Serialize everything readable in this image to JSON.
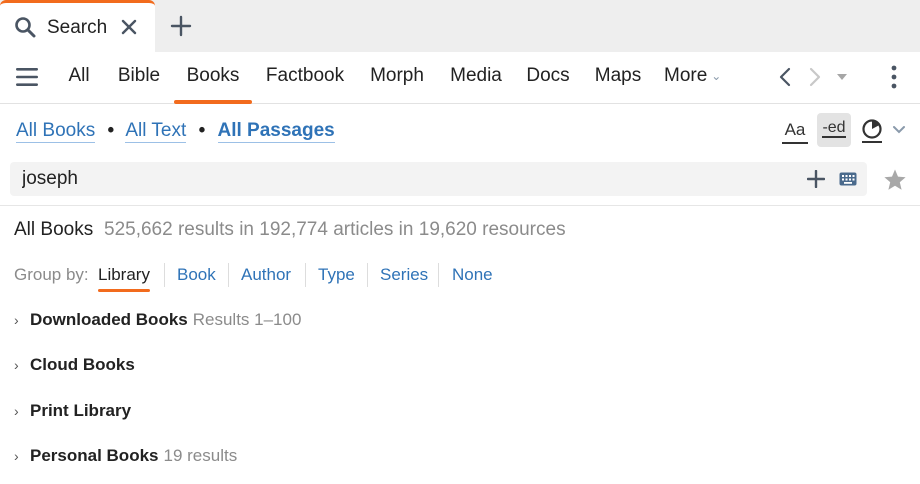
{
  "tab": {
    "title": "Search"
  },
  "nav": {
    "items": [
      {
        "label": "All"
      },
      {
        "label": "Bible"
      },
      {
        "label": "Books"
      },
      {
        "label": "Factbook"
      },
      {
        "label": "Morph"
      },
      {
        "label": "Media"
      },
      {
        "label": "Docs"
      },
      {
        "label": "Maps"
      },
      {
        "label": "More"
      }
    ],
    "active": "Books"
  },
  "scope": {
    "books": "All Books",
    "text": "All Text",
    "passages": "All Passages",
    "separator": "•"
  },
  "tools": {
    "font_label": "Aa",
    "ed_label": "-ed"
  },
  "search": {
    "value": "joseph"
  },
  "results": {
    "title": "All Books",
    "summary": "525,662 results in 192,774 articles in 19,620 resources"
  },
  "group_by": {
    "label": "Group by:",
    "options": [
      "Library",
      "Book",
      "Author",
      "Type",
      "Series",
      "None"
    ],
    "active": "Library"
  },
  "groups": [
    {
      "name": "Downloaded Books",
      "count": "Results 1–100"
    },
    {
      "name": "Cloud Books",
      "count": ""
    },
    {
      "name": "Print Library",
      "count": ""
    },
    {
      "name": "Personal Books",
      "count": "19 results"
    }
  ],
  "colors": {
    "accent": "#f26b1d",
    "link": "#2f73b7",
    "muted": "#8b8b8b"
  },
  "icons": [
    "search-icon",
    "close-icon",
    "plus-icon",
    "hamburger-icon",
    "chevron-down-icon",
    "back-arrow-icon",
    "forward-arrow-icon",
    "kebab-menu-icon",
    "circle-toggle-icon",
    "keyboard-icon",
    "star-icon",
    "chevron-right-icon"
  ]
}
